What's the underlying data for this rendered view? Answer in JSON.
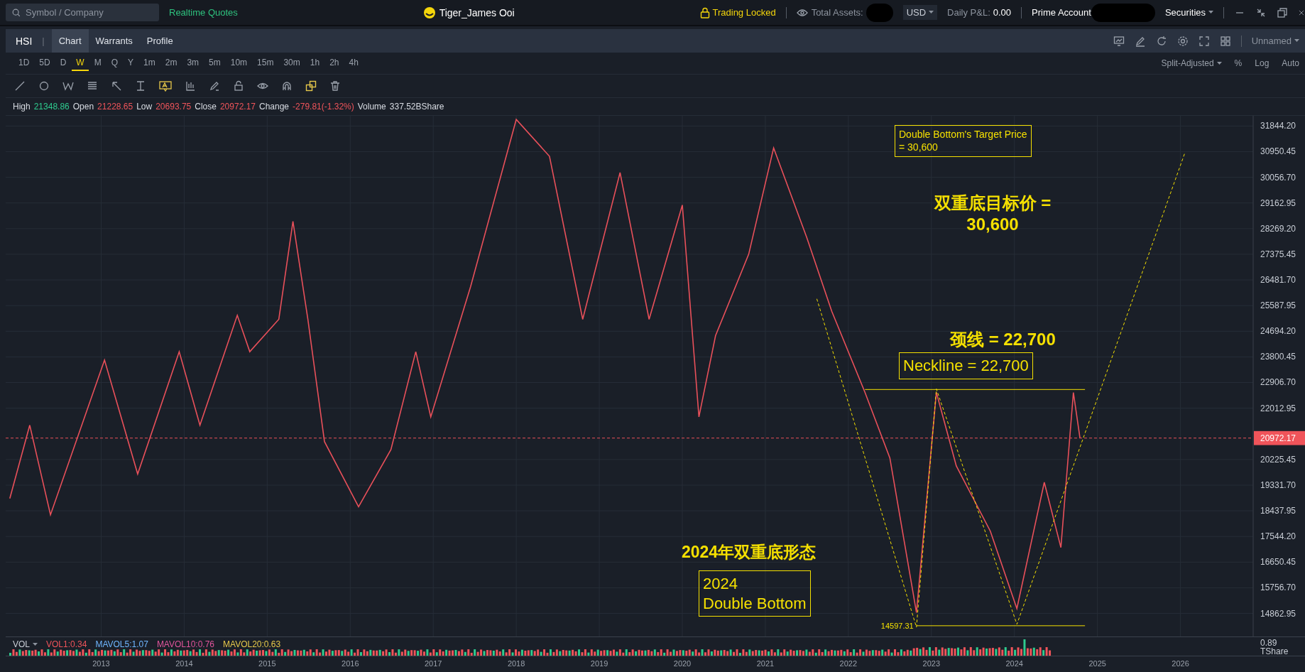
{
  "top_bar": {
    "search": {
      "placeholder": "Symbol / Company"
    },
    "quotes_link": "Realtime Quotes",
    "user": "Tiger_James Ooi",
    "trading": "Trading Locked",
    "total_assets_label": "Total Assets:",
    "currency": "USD",
    "pnl_label": "Daily P&L:",
    "pnl_value": "0.00",
    "account": "Prime Account",
    "securities": "Securities"
  },
  "tab_bar": {
    "symbol": "HSI",
    "separator": "|",
    "tabs": [
      {
        "label": "Chart",
        "selected": true
      },
      {
        "label": "Warrants",
        "selected": false
      },
      {
        "label": "Profile",
        "selected": false
      }
    ],
    "layout": "Unnamed"
  },
  "intervals": [
    {
      "label": "1D",
      "selected": false
    },
    {
      "label": "5D",
      "selected": false
    },
    {
      "label": "D",
      "selected": false
    },
    {
      "label": "W",
      "selected": true
    },
    {
      "label": "M",
      "selected": false
    },
    {
      "label": "Q",
      "selected": false
    },
    {
      "label": "Y",
      "selected": false
    },
    {
      "label": "1m",
      "selected": false
    },
    {
      "label": "2m",
      "selected": false
    },
    {
      "label": "3m",
      "selected": false
    },
    {
      "label": "5m",
      "selected": false
    },
    {
      "label": "10m",
      "selected": false
    },
    {
      "label": "15m",
      "selected": false
    },
    {
      "label": "30m",
      "selected": false
    },
    {
      "label": "1h",
      "selected": false
    },
    {
      "label": "2h",
      "selected": false
    },
    {
      "label": "4h",
      "selected": false
    }
  ],
  "chart_options": {
    "adjust": "Split-Adjusted",
    "percent": "%",
    "log": "Log",
    "auto": "Auto"
  },
  "quote_info": [
    {
      "label": "High",
      "value": "21348.86",
      "color": "#2ecc8f"
    },
    {
      "label": "Open",
      "value": "21228.65",
      "color": "#f0545a"
    },
    {
      "label": "Low",
      "value": "20693.75",
      "color": "#f0545a"
    },
    {
      "label": "Close",
      "value": "20972.17",
      "color": "#f0545a"
    },
    {
      "label": "Change",
      "value": "-279.81(-1.32%)",
      "color": "#f0545a"
    },
    {
      "label": "Volume",
      "value": "337.52BShare",
      "color": "#d8dce3"
    }
  ],
  "chart": {
    "current_price": "20972.17",
    "low_label": "14597.31",
    "annotations": [
      {
        "kind": "box",
        "lines": [
          "Double Bottom's Target Price",
          "= 30,600"
        ]
      },
      {
        "kind": "text",
        "lines": [
          "双重底目标价 =",
          "30,600"
        ]
      },
      {
        "kind": "text",
        "lines": [
          "颈线 = 22,700"
        ]
      },
      {
        "kind": "box",
        "lines": [
          "Neckline = 22,700"
        ]
      },
      {
        "kind": "text",
        "lines": [
          "2024年双重底形态"
        ]
      },
      {
        "kind": "box",
        "lines": [
          "2024",
          "Double Bottom"
        ]
      }
    ],
    "chart_data": {
      "type": "line",
      "xlim": [
        2011.85,
        2027.5
      ],
      "ylim": [
        14060,
        32200
      ],
      "grid": true,
      "ref_lines": [
        {
          "axis": "y",
          "value": 20972.17,
          "color": "#e8505a"
        }
      ],
      "x": [
        2011.9,
        2012.14,
        2012.39,
        2013.04,
        2013.44,
        2013.94,
        2014.19,
        2014.64,
        2014.79,
        2015.14,
        2015.31,
        2015.49,
        2015.69,
        2016.1,
        2016.49,
        2016.79,
        2016.97,
        2017.45,
        2018.0,
        2018.4,
        2018.8,
        2019.25,
        2019.6,
        2020.0,
        2020.2,
        2020.4,
        2020.8,
        2021.1,
        2021.5,
        2021.8,
        2022.2,
        2022.5,
        2022.82,
        2023.06,
        2023.3,
        2023.71,
        2024.03,
        2024.36,
        2024.56,
        2024.71,
        2024.79
      ],
      "values": [
        18870,
        21420,
        18300,
        23690,
        19720,
        23980,
        21420,
        25250,
        23980,
        25110,
        28520,
        25110,
        20850,
        18580,
        20570,
        23980,
        21710,
        26250,
        32070,
        30790,
        25110,
        30220,
        25110,
        29090,
        21710,
        24540,
        27380,
        31080,
        27950,
        25390,
        22560,
        20280,
        14890,
        22560,
        20000,
        17730,
        15030,
        19430,
        17160,
        22560,
        20970
      ],
      "xticks": [
        {
          "value": 2013,
          "label": "2013"
        },
        {
          "value": 2014,
          "label": "2014"
        },
        {
          "value": 2015,
          "label": "2015"
        },
        {
          "value": 2016,
          "label": "2016"
        },
        {
          "value": 2017,
          "label": "2017"
        },
        {
          "value": 2018,
          "label": "2018"
        },
        {
          "value": 2019,
          "label": "2019"
        },
        {
          "value": 2020,
          "label": "2020"
        },
        {
          "value": 2021,
          "label": "2021"
        },
        {
          "value": 2022,
          "label": "2022"
        },
        {
          "value": 2023,
          "label": "2023"
        },
        {
          "value": 2024,
          "label": "2024"
        },
        {
          "value": 2025,
          "label": "2025"
        },
        {
          "value": 2026,
          "label": "2026"
        }
      ],
      "yticks": [
        {
          "value": 31844.2,
          "label": "31844.20"
        },
        {
          "value": 30950.45,
          "label": "30950.45"
        },
        {
          "value": 30056.7,
          "label": "30056.70"
        },
        {
          "value": 29162.95,
          "label": "29162.95"
        },
        {
          "value": 28269.2,
          "label": "28269.20"
        },
        {
          "value": 27375.45,
          "label": "27375.45"
        },
        {
          "value": 26481.7,
          "label": "26481.70"
        },
        {
          "value": 25587.95,
          "label": "25587.95"
        },
        {
          "value": 24694.2,
          "label": "24694.20"
        },
        {
          "value": 23800.45,
          "label": "23800.45"
        },
        {
          "value": 22906.7,
          "label": "22906.70"
        },
        {
          "value": 22012.95,
          "label": "22012.95"
        },
        {
          "value": 20225.45,
          "label": "20225.45"
        },
        {
          "value": 19331.7,
          "label": "19331.70"
        },
        {
          "value": 18437.95,
          "label": "18437.95"
        },
        {
          "value": 17544.2,
          "label": "17544.20"
        },
        {
          "value": 16650.45,
          "label": "16650.45"
        },
        {
          "value": 15756.7,
          "label": "15756.70"
        },
        {
          "value": 14862.95,
          "label": "14862.95"
        }
      ]
    }
  },
  "volume": {
    "label": "VOL",
    "indicators": [
      {
        "label": "VOL1:0.34",
        "color": "#f0545a"
      },
      {
        "label": "MAVOL5:1.07",
        "color": "#6fb6ff"
      },
      {
        "label": "MAVOL10:0.76",
        "color": "#e0559b"
      },
      {
        "label": "MAVOL20:0.63",
        "color": "#e6c84a"
      }
    ],
    "axis_value": "0.89",
    "axis_unit": "TShare"
  }
}
